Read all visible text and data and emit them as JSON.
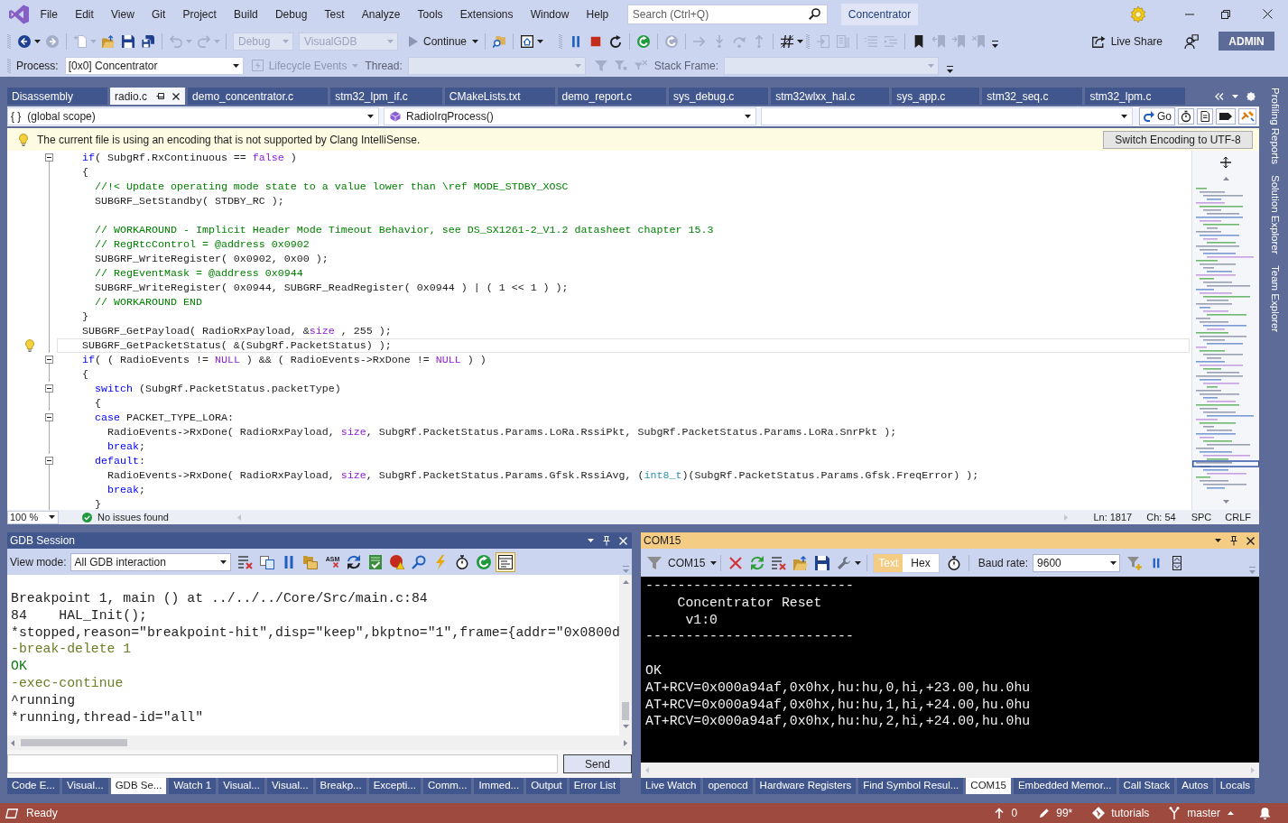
{
  "title_bar": {
    "menu": [
      "File",
      "Edit",
      "View",
      "Git",
      "Project",
      "Build",
      "Debug",
      "Test",
      "Analyze",
      "Tools",
      "Extensions",
      "Window",
      "Help"
    ],
    "search": {
      "placeholder": "Search (Ctrl+Q)"
    },
    "solution": "Concentrator"
  },
  "toolbars": [
    {
      "groups": [
        [
          {
            "kind": "back",
            "disabled": false,
            "menu": true
          },
          {
            "kind": "forward",
            "disabled": true,
            "menu": false
          }
        ],
        [
          {
            "kind": "new-item",
            "disabled": true,
            "menu": true
          },
          {
            "kind": "open-folder",
            "disabled": false,
            "menu": false
          },
          {
            "kind": "save",
            "disabled": false,
            "menu": false
          },
          {
            "kind": "save-all",
            "disabled": false,
            "menu": false
          }
        ],
        [
          {
            "kind": "undo",
            "disabled": true,
            "menu": true
          },
          {
            "kind": "redo",
            "disabled": true,
            "menu": true
          }
        ],
        [
          {
            "kind": "combo",
            "text": "Debug",
            "disabled": true,
            "menu": true
          },
          {
            "kind": "combo",
            "text": "VisualGDB",
            "disabled": true,
            "menu": true
          },
          {
            "kind": "continue",
            "text": "Continue",
            "disabled": false,
            "menu": true
          }
        ],
        [
          {
            "kind": "find-in-files",
            "disabled": false,
            "menu": false
          }
        ],
        [
          {
            "kind": "window",
            "disabled": false,
            "menu": true
          }
        ]
      ]
    },
    {
      "groups": [
        [
          {
            "kind": "pause",
            "disabled": false,
            "menu": false
          },
          {
            "kind": "stop",
            "disabled": false,
            "menu": false
          },
          {
            "kind": "restart",
            "disabled": false,
            "menu": false
          }
        ],
        [
          {
            "kind": "refresh",
            "disabled": false,
            "menu": false
          }
        ],
        [
          {
            "kind": "refresh",
            "disabled": true,
            "menu": false
          }
        ],
        [
          {
            "kind": "show-next",
            "disabled": true,
            "menu": false
          },
          {
            "kind": "step-into",
            "disabled": true,
            "menu": false
          },
          {
            "kind": "step-over",
            "disabled": true,
            "menu": false
          },
          {
            "kind": "step-out",
            "disabled": true,
            "menu": false
          }
        ],
        [
          {
            "kind": "hash",
            "disabled": false,
            "menu": true
          }
        ]
      ]
    },
    {
      "groups": [
        [
          {
            "kind": "panel-in",
            "disabled": true,
            "menu": false
          },
          {
            "kind": "panel-out",
            "disabled": true,
            "menu": false
          }
        ],
        [
          {
            "kind": "outdent",
            "disabled": true,
            "menu": false
          },
          {
            "kind": "indent",
            "disabled": true,
            "menu": false
          }
        ],
        [
          {
            "kind": "bookmark",
            "disabled": false,
            "menu": false
          },
          {
            "kind": "bookmark-back",
            "disabled": true,
            "menu": false
          },
          {
            "kind": "bookmark-forward",
            "disabled": true,
            "menu": false
          },
          {
            "kind": "bookmark-x",
            "disabled": true,
            "menu": false
          }
        ]
      ]
    }
  ],
  "live_share": "Live Share",
  "account": "ADMIN",
  "debug_location": {
    "process_label": "Process:",
    "process": "[0x0] Concentrator",
    "lifecycle": {
      "text": "Lifecycle Events",
      "disabled": true
    },
    "thread_label": "Thread:",
    "thread": {
      "disabled": true
    },
    "filters": [
      {
        "kind": "funnel",
        "disabled": true
      },
      {
        "kind": "funnel-flag",
        "disabled": true
      },
      {
        "kind": "funnel-cross",
        "disabled": true
      }
    ],
    "stack_label": "Stack Frame:",
    "stack_frame": {
      "disabled": true
    }
  },
  "document_tabs": [
    {
      "label": "Disassembly",
      "selected": false
    },
    {
      "label": "radio.c",
      "selected": true
    },
    {
      "label": "demo_concentrator.c",
      "selected": false
    },
    {
      "label": "stm32_lpm_if.c",
      "selected": false
    },
    {
      "label": "CMakeLists.txt",
      "selected": false
    },
    {
      "label": "demo_report.c",
      "selected": false
    },
    {
      "label": "sys_debug.c",
      "selected": false
    },
    {
      "label": "stm32wlxx_hal.c",
      "selected": false
    },
    {
      "label": "sys_app.c",
      "selected": false
    },
    {
      "label": "stm32_seq.c",
      "selected": false
    },
    {
      "label": "stm32_lpm.c",
      "selected": false
    }
  ],
  "navigation_bar": {
    "scope_glyph": "{ }",
    "scope": "(global scope)",
    "function": "RadioIrqProcess()",
    "go": "Go"
  },
  "info_bar": {
    "message": "The current file is using an encoding that is not supported by Clang IntelliSense.",
    "action": "Switch Encoding to UTF-8"
  },
  "editor": {
    "lines": [
      {
        "tokens": [
          {
            "kind": "keyword",
            "text": "    if"
          },
          {
            "kind": "plain",
            "text": "( SubgRf.RxContinuous == "
          },
          {
            "kind": "macro",
            "text": "false"
          },
          {
            "kind": "plain",
            "text": " )"
          }
        ],
        "fold": true,
        "bulb": false,
        "current": false
      },
      {
        "tokens": [
          {
            "kind": "plain",
            "text": "    {"
          }
        ],
        "fold": false,
        "bulb": false,
        "current": false
      },
      {
        "tokens": [
          {
            "kind": "comment",
            "text": "      //!< Update operating mode state to a value lower than \\ref MODE_STDBY_XOSC"
          }
        ],
        "fold": false,
        "bulb": false,
        "current": false
      },
      {
        "tokens": [
          {
            "kind": "plain",
            "text": "      SUBGRF_SetStandby( STDBY_RC );"
          }
        ],
        "fold": false,
        "bulb": false,
        "current": false
      },
      {
        "fold": false,
        "bulb": false,
        "current": false
      },
      {
        "tokens": [
          {
            "kind": "comment",
            "text": "      // WORKAROUND - Implicit Header Mode Timeout Behavior, see DS_SX1261-2_V1.2 datasheet chapter 15.3"
          }
        ],
        "fold": false,
        "bulb": false,
        "current": false
      },
      {
        "tokens": [
          {
            "kind": "comment",
            "text": "      // RegRtcControl = @address 0x0902"
          }
        ],
        "fold": false,
        "bulb": false,
        "current": false
      },
      {
        "tokens": [
          {
            "kind": "plain",
            "text": "      SUBGRF_WriteRegister( 0x0902, 0x00 );"
          }
        ],
        "fold": false,
        "bulb": false,
        "current": false
      },
      {
        "tokens": [
          {
            "kind": "comment",
            "text": "      // RegEventMask = @address 0x0944"
          }
        ],
        "fold": false,
        "bulb": false,
        "current": false
      },
      {
        "tokens": [
          {
            "kind": "plain",
            "text": "      SUBGRF_WriteRegister( 0x0944, SUBGRF_ReadRegister( 0x0944 ) | ( 1 << 1 ) );"
          }
        ],
        "fold": false,
        "bulb": false,
        "current": false
      },
      {
        "tokens": [
          {
            "kind": "comment",
            "text": "      // WORKAROUND END"
          }
        ],
        "fold": false,
        "bulb": false,
        "current": false
      },
      {
        "tokens": [
          {
            "kind": "plain",
            "text": "    }"
          }
        ],
        "fold": false,
        "bulb": false,
        "current": false
      },
      {
        "tokens": [
          {
            "kind": "plain",
            "text": "    SUBGRF_GetPayload( RadioRxPayload, &"
          },
          {
            "kind": "macro",
            "text": "size"
          },
          {
            "kind": "plain",
            "text": " , 255 );"
          }
        ],
        "fold": false,
        "bulb": false,
        "current": false
      },
      {
        "tokens": [
          {
            "kind": "plain",
            "text": "    SUBGRF_GetPacketStatus( &(SubgRf.PacketStatus) );"
          }
        ],
        "fold": false,
        "bulb": true,
        "current": true
      },
      {
        "tokens": [
          {
            "kind": "keyword",
            "text": "    if"
          },
          {
            "kind": "plain",
            "text": "( ( RadioEvents != "
          },
          {
            "kind": "macro",
            "text": "NULL"
          },
          {
            "kind": "plain",
            "text": " ) && ( RadioEvents->RxDone != "
          },
          {
            "kind": "macro",
            "text": "NULL"
          },
          {
            "kind": "plain",
            "text": " ) )"
          }
        ],
        "fold": true,
        "bulb": false,
        "current": false
      },
      {
        "tokens": [
          {
            "kind": "plain",
            "text": "    {"
          }
        ],
        "fold": false,
        "bulb": false,
        "current": false
      },
      {
        "tokens": [
          {
            "kind": "keyword",
            "text": "      switch"
          },
          {
            "kind": "plain",
            "text": " (SubgRf.PacketStatus.packetType)"
          }
        ],
        "fold": true,
        "bulb": false,
        "current": false
      },
      {
        "tokens": [
          {
            "kind": "plain",
            "text": "      {"
          }
        ],
        "fold": false,
        "bulb": false,
        "current": false
      },
      {
        "tokens": [
          {
            "kind": "keyword",
            "text": "      case"
          },
          {
            "kind": "plain",
            "text": " PACKET_TYPE_LORA:"
          }
        ],
        "fold": true,
        "bulb": false,
        "current": false
      },
      {
        "tokens": [
          {
            "kind": "plain",
            "text": "        RadioEvents->RxDone( RadioRxPayload, "
          },
          {
            "kind": "macro",
            "text": "size"
          },
          {
            "kind": "plain",
            "text": ", SubgRf.PacketStatus.Params.LoRa.RssiPkt, SubgRf.PacketStatus.Params.LoRa.SnrPkt );"
          }
        ],
        "fold": false,
        "bulb": false,
        "current": false
      },
      {
        "tokens": [
          {
            "kind": "keyword",
            "text": "        break"
          },
          {
            "kind": "plain",
            "text": ";"
          }
        ],
        "fold": false,
        "bulb": false,
        "current": false
      },
      {
        "tokens": [
          {
            "kind": "keyword",
            "text": "      default"
          },
          {
            "kind": "plain",
            "text": ":"
          }
        ],
        "fold": true,
        "bulb": false,
        "current": false
      },
      {
        "tokens": [
          {
            "kind": "plain",
            "text": "        RadioEvents->RxDone( RadioRxPayload, "
          },
          {
            "kind": "macro",
            "text": "size"
          },
          {
            "kind": "plain",
            "text": ", SubgRf.PacketStatus.Params.Gfsk.RssiAvg, ("
          },
          {
            "kind": "type",
            "text": "int8_t"
          },
          {
            "kind": "plain",
            "text": ")(SubgRf.PacketStatus.Params.Gfsk.FreqError) );"
          }
        ],
        "fold": false,
        "bulb": false,
        "current": false
      },
      {
        "tokens": [
          {
            "kind": "keyword",
            "text": "        break"
          },
          {
            "kind": "plain",
            "text": ";"
          }
        ],
        "fold": false,
        "bulb": false,
        "current": false
      },
      {
        "tokens": [
          {
            "kind": "plain",
            "text": "      }"
          }
        ],
        "fold": false,
        "bulb": false,
        "current": false
      }
    ],
    "zoom": "100 %",
    "issues": "No issues found",
    "line": "Ln: 1817",
    "column": "Ch: 54",
    "indentation": "SPC",
    "line_ending": "CRLF"
  },
  "side_tabs": [
    "Profiling Reports",
    "Solution Explorer",
    "Team Explorer"
  ],
  "gdb_panel": {
    "title": "GDB Session",
    "active": false,
    "view_mode_label": "View mode:",
    "view_mode": "All GDB interaction",
    "tools": [
      {
        "kind": "clear",
        "on": false
      },
      {
        "kind": "copy",
        "on": false
      },
      {
        "kind": "pause",
        "on": false
      },
      {
        "kind": "folders",
        "on": false
      },
      {
        "kind": "asm",
        "label": "ASM",
        "on": false
      },
      {
        "kind": "sync",
        "on": false
      },
      {
        "kind": "checklist",
        "on": false
      },
      {
        "kind": "breakpoint-warning",
        "on": false
      },
      {
        "kind": "search",
        "on": false
      },
      {
        "kind": "lightning",
        "on": false
      },
      {
        "kind": "stopwatch",
        "on": false
      },
      {
        "kind": "refresh",
        "on": false
      },
      {
        "kind": "window-lines",
        "on": true
      }
    ],
    "output": [
      {
        "kind": "output",
        "text": "Breakpoint 1, main () at ../../../Core/Src/main.c:84"
      },
      {
        "kind": "output",
        "text": "84    HAL_Init();"
      },
      {
        "kind": "output",
        "text": "*stopped,reason=\"breakpoint-hit\",disp=\"keep\",bkptno=\"1\",frame={addr=\"0x0800d"
      },
      {
        "kind": "command",
        "text": "-break-delete 1"
      },
      {
        "kind": "result",
        "text": "OK"
      },
      {
        "kind": "command",
        "text": "-exec-continue"
      },
      {
        "kind": "output",
        "text": "^running"
      },
      {
        "kind": "output",
        "text": "*running,thread-id=\"all\""
      }
    ],
    "send": "Send",
    "tabs": [
      {
        "label": "Code E...",
        "selected": false
      },
      {
        "label": "Visual...",
        "selected": false
      },
      {
        "label": "GDB Se...",
        "selected": true
      },
      {
        "label": "Watch 1",
        "selected": false
      },
      {
        "label": "Visual...",
        "selected": false
      },
      {
        "label": "Visual...",
        "selected": false
      },
      {
        "label": "Breakp...",
        "selected": false
      },
      {
        "label": "Excepti...",
        "selected": false
      },
      {
        "label": "Comm...",
        "selected": false
      },
      {
        "label": "Immed...",
        "selected": false
      },
      {
        "label": "Output",
        "selected": false
      },
      {
        "label": "Error List",
        "selected": false
      }
    ]
  },
  "com_panel": {
    "title": "COM15",
    "active": true,
    "port": "COM15",
    "modes": [
      {
        "label": "Text",
        "selected": true
      },
      {
        "label": "Hex",
        "selected": false
      }
    ],
    "baud_label": "Baud rate:",
    "baud": "9600",
    "lines": [
      {
        "kind": "text",
        "text": "--------------------------"
      },
      {
        "kind": "text",
        "text": "    Concentrator Reset"
      },
      {
        "kind": "text",
        "text": "     v1:0"
      },
      {
        "kind": "text",
        "text": "--------------------------"
      },
      {
        "kind": "blank"
      },
      {
        "kind": "text",
        "text": "OK"
      },
      {
        "kind": "text",
        "text": "AT+RCV=0x000a94af,0x0hx,hu:hu,0,hi,+23.00,hu.0hu"
      },
      {
        "kind": "text",
        "text": "AT+RCV=0x000a94af,0x0hx,hu:hu,1,hi,+24.00,hu.0hu"
      },
      {
        "kind": "text",
        "text": "AT+RCV=0x000a94af,0x0hx,hu:hu,2,hi,+24.00,hu.0hu"
      }
    ],
    "tabs": [
      {
        "label": "Live Watch",
        "selected": false
      },
      {
        "label": "openocd",
        "selected": false
      },
      {
        "label": "Hardware Registers",
        "selected": false
      },
      {
        "label": "Find Symbol Resul...",
        "selected": false
      },
      {
        "label": "COM15",
        "selected": true
      },
      {
        "label": "Embedded Memor...",
        "selected": false
      },
      {
        "label": "Call Stack",
        "selected": false
      },
      {
        "label": "Autos",
        "selected": false
      },
      {
        "label": "Locals",
        "selected": false
      }
    ]
  },
  "status_bar": {
    "state": "Ready",
    "outgoing": "0",
    "changes": "99*",
    "repository": "tutorials",
    "branch": "master"
  }
}
